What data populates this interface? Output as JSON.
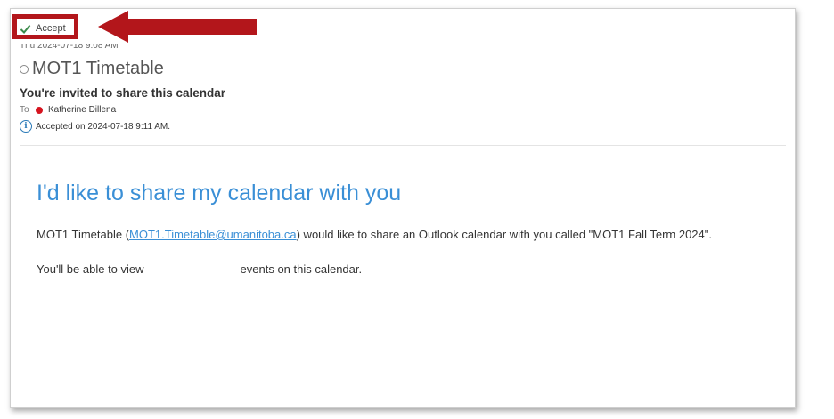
{
  "toolbar": {
    "accept_label": "Accept"
  },
  "message": {
    "date": "Thu 2024-07-18 9:08 AM",
    "subject": "MOT1 Timetable",
    "invite_heading": "You're invited to share this calendar",
    "to_label": "To",
    "recipient": "Katherine Dillena",
    "status": "Accepted on 2024-07-18 9:11 AM."
  },
  "body": {
    "heading": "I'd like to share my calendar with you",
    "para1_prefix": "MOT1 Timetable (",
    "para1_email": "MOT1.Timetable@umanitoba.ca",
    "para1_suffix": ") would like to share an Outlook calendar with you called \"MOT1 Fall Term 2024\".",
    "para2_prefix": "You'll be able to view",
    "para2_suffix": "events on this calendar."
  },
  "colors": {
    "highlight_red": "#b3161b",
    "accent_blue": "#3a8fd6",
    "check_green": "#3a8a4a",
    "presence_red": "#d6141f"
  },
  "icons": [
    "check-icon",
    "arrow-pointer",
    "status-circle-icon",
    "presence-dot-icon",
    "info-icon"
  ]
}
